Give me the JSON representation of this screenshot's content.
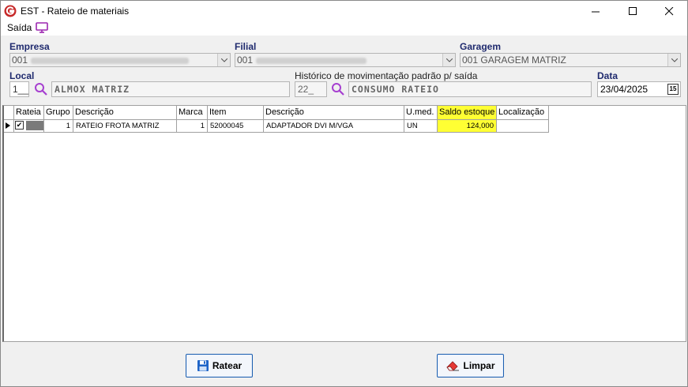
{
  "window": {
    "title": "EST - Rateio de materiais",
    "controls": {
      "minimize": "—",
      "maximize": "☐",
      "close": "✕"
    }
  },
  "menu": {
    "saida_label": "Saída",
    "screen_icon": "monitor-icon"
  },
  "form": {
    "empresa": {
      "label": "Empresa",
      "value": "001"
    },
    "filial": {
      "label": "Filial",
      "value": "001"
    },
    "garagem": {
      "label": "Garagem",
      "value": "001 GARAGEM MATRIZ"
    },
    "local": {
      "label": "Local",
      "code": "1__",
      "description": "ALMOX MATRIZ"
    },
    "historico": {
      "label": "Histórico de movimentação padrão p/ saída",
      "code": "22_",
      "description": "CONSUMO RATEIO"
    },
    "data": {
      "label": "Data",
      "value": "23/04/2025",
      "calendar_badge": "15"
    }
  },
  "grid": {
    "columns": [
      "Rateia",
      "Grupo",
      "Descrição",
      "Marca",
      "Item",
      "Descrição",
      "U.med.",
      "Saldo estoque",
      "Localização"
    ],
    "rows": [
      {
        "rateia": "✔",
        "grupo": "1",
        "descricao_grupo": "RATEIO FROTA MATRIZ",
        "marca": "1",
        "item": "52000045",
        "descricao_item": "ADAPTADOR DVI M/VGA",
        "umed": "UN",
        "saldo": "124,000",
        "localizacao": ""
      }
    ],
    "highlight_color": "#ffff33"
  },
  "buttons": {
    "ratear": {
      "label": "Ratear",
      "icon": "floppy-disk-icon"
    },
    "limpar": {
      "label": "Limpar",
      "icon": "eraser-icon"
    }
  }
}
